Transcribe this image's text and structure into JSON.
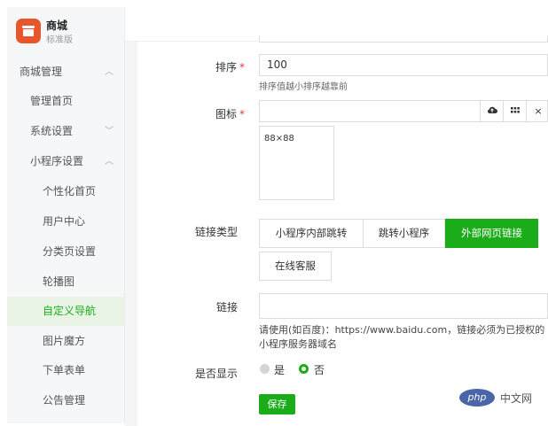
{
  "brand": {
    "name": "商城",
    "subtitle": "标准版"
  },
  "sidebar": {
    "items": [
      {
        "label": "商城管理",
        "chevron": "︿"
      },
      {
        "label": "管理首页"
      },
      {
        "label": "系统设置",
        "chevron": "﹀"
      },
      {
        "label": "小程序设置",
        "chevron": "︿"
      },
      {
        "label": "个性化首页"
      },
      {
        "label": "用户中心"
      },
      {
        "label": "分类页设置"
      },
      {
        "label": "轮播图"
      },
      {
        "label": "自定义导航"
      },
      {
        "label": "图片魔方"
      },
      {
        "label": "下单表单"
      },
      {
        "label": "公告管理"
      }
    ]
  },
  "form": {
    "sort": {
      "label": "排序",
      "required": "*",
      "value": "100",
      "help": "排序值越小排序越靠前"
    },
    "icon": {
      "label": "图标",
      "required": "*",
      "preview_size": "88×88",
      "buttons": {
        "clear": "×"
      }
    },
    "link_type": {
      "label": "链接类型",
      "options": [
        "小程序内部跳转",
        "跳转小程序",
        "外部网页链接",
        "在线客服"
      ],
      "selected": "外部网页链接"
    },
    "link": {
      "label": "链接",
      "value": "",
      "help_line1": "请使用(如百度)：https://www.baidu.com，链接必须为已授权的",
      "help_line2": "小程序服务器域名"
    },
    "show": {
      "label": "是否显示",
      "options": [
        "是",
        "否"
      ],
      "selected": "否"
    },
    "save_label": "保存"
  },
  "watermark": {
    "text": "php",
    "tail": "中文网"
  },
  "colors": {
    "accent": "#1aad19",
    "brand": "#e8572b",
    "required": "#e4393c"
  }
}
